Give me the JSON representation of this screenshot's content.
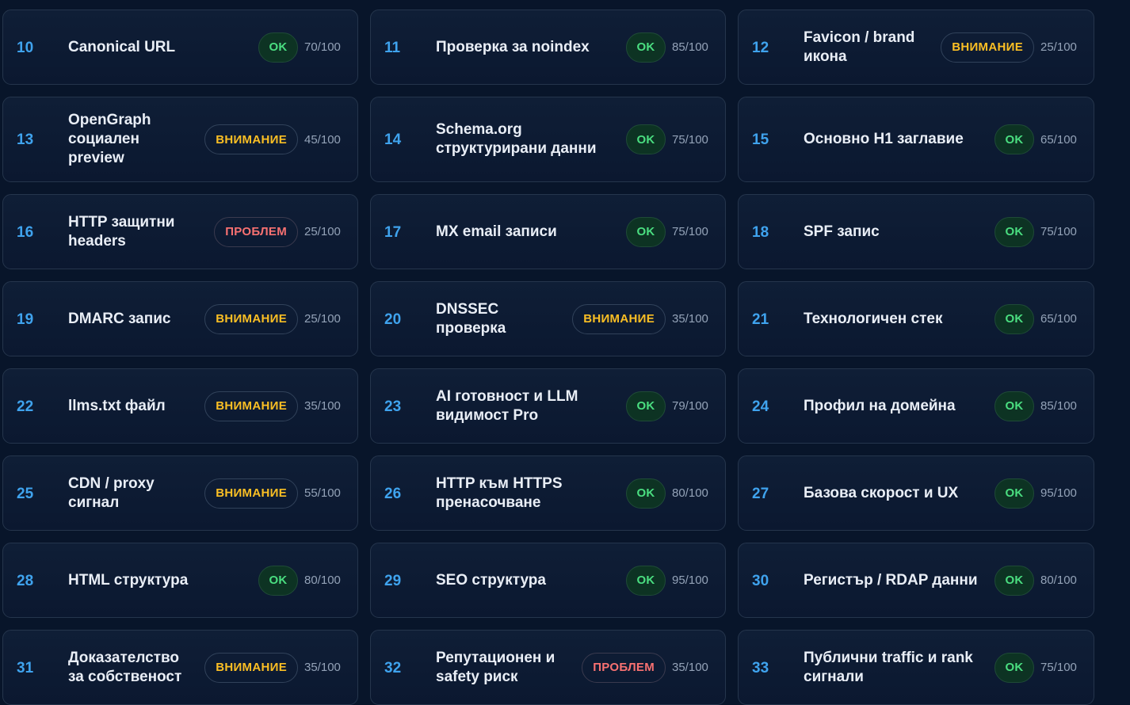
{
  "colors": {
    "background": "#08152a",
    "card": "#0f1e36",
    "number": "#3fa3ee",
    "ok": "#4ade80",
    "warning": "#fbbf24",
    "problem": "#f87171"
  },
  "checks": [
    {
      "num": "10",
      "title": "Canonical URL",
      "status": "ok",
      "badge": "OK",
      "score": "70/100"
    },
    {
      "num": "11",
      "title": "Проверка за noindex",
      "status": "ok",
      "badge": "OK",
      "score": "85/100"
    },
    {
      "num": "12",
      "title": "Favicon / brand икона",
      "status": "warn",
      "badge": "ВНИМАНИЕ",
      "score": "25/100"
    },
    {
      "num": "13",
      "title": "OpenGraph социален preview",
      "status": "warn",
      "badge": "ВНИМАНИЕ",
      "score": "45/100"
    },
    {
      "num": "14",
      "title": "Schema.org структурирани данни",
      "status": "ok",
      "badge": "OK",
      "score": "75/100"
    },
    {
      "num": "15",
      "title": "Основно H1 заглавие",
      "status": "ok",
      "badge": "OK",
      "score": "65/100"
    },
    {
      "num": "16",
      "title": "HTTP защитни headers",
      "status": "bad",
      "badge": "ПРОБЛЕМ",
      "score": "25/100"
    },
    {
      "num": "17",
      "title": "MX email записи",
      "status": "ok",
      "badge": "OK",
      "score": "75/100"
    },
    {
      "num": "18",
      "title": "SPF запис",
      "status": "ok",
      "badge": "OK",
      "score": "75/100"
    },
    {
      "num": "19",
      "title": "DMARC запис",
      "status": "warn",
      "badge": "ВНИМАНИЕ",
      "score": "25/100"
    },
    {
      "num": "20",
      "title": "DNSSEC проверка",
      "status": "warn",
      "badge": "ВНИМАНИЕ",
      "score": "35/100"
    },
    {
      "num": "21",
      "title": "Технологичен стек",
      "status": "ok",
      "badge": "OK",
      "score": "65/100"
    },
    {
      "num": "22",
      "title": "llms.txt файл",
      "status": "warn",
      "badge": "ВНИМАНИЕ",
      "score": "35/100"
    },
    {
      "num": "23",
      "title": "AI готовност и LLM видимост Pro",
      "status": "ok",
      "badge": "OK",
      "score": "79/100"
    },
    {
      "num": "24",
      "title": "Профил на домейна",
      "status": "ok",
      "badge": "OK",
      "score": "85/100"
    },
    {
      "num": "25",
      "title": "CDN / proxy сигнал",
      "status": "warn",
      "badge": "ВНИМАНИЕ",
      "score": "55/100"
    },
    {
      "num": "26",
      "title": "HTTP към HTTPS пренасочване",
      "status": "ok",
      "badge": "OK",
      "score": "80/100"
    },
    {
      "num": "27",
      "title": "Базова скорост и UX",
      "status": "ok",
      "badge": "OK",
      "score": "95/100"
    },
    {
      "num": "28",
      "title": "HTML структура",
      "status": "ok",
      "badge": "OK",
      "score": "80/100"
    },
    {
      "num": "29",
      "title": "SEO структура",
      "status": "ok",
      "badge": "OK",
      "score": "95/100"
    },
    {
      "num": "30",
      "title": "Регистър / RDAP данни",
      "status": "ok",
      "badge": "OK",
      "score": "80/100"
    },
    {
      "num": "31",
      "title": "Доказателство за собственост",
      "status": "warn",
      "badge": "ВНИМАНИЕ",
      "score": "35/100"
    },
    {
      "num": "32",
      "title": "Репутационен и safety риск",
      "status": "bad",
      "badge": "ПРОБЛЕМ",
      "score": "35/100"
    },
    {
      "num": "33",
      "title": "Публични traffic и rank сигнали",
      "status": "ok",
      "badge": "OK",
      "score": "75/100"
    }
  ]
}
